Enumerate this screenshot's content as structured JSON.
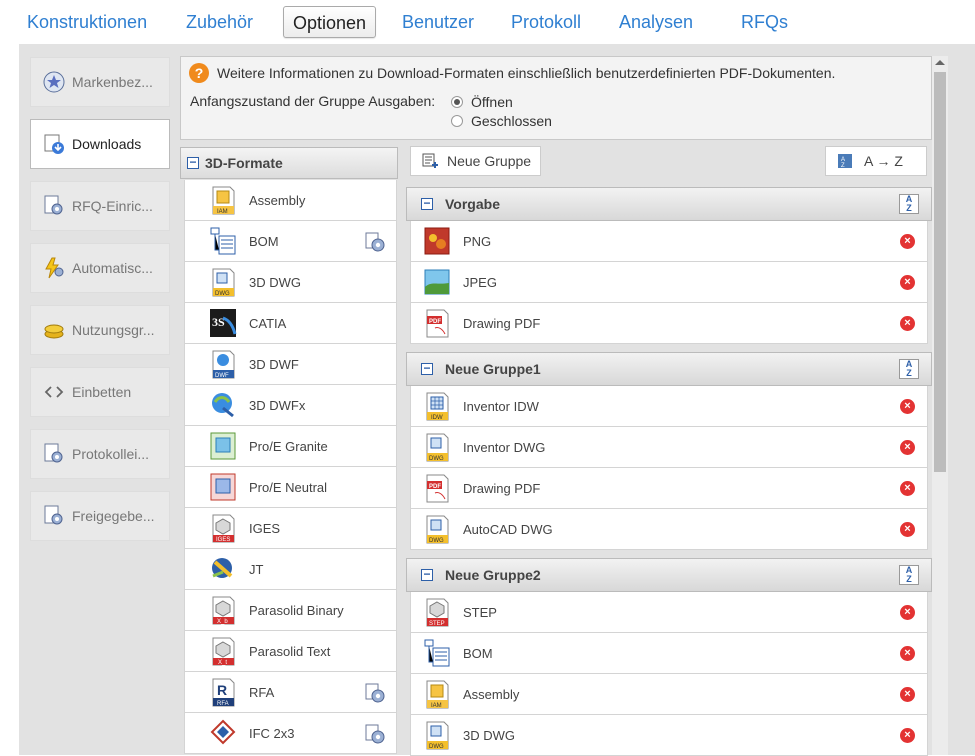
{
  "nav": {
    "tabs": [
      {
        "label": "Konstruktionen"
      },
      {
        "label": "Zubehör"
      },
      {
        "label": "Optionen"
      },
      {
        "label": "Benutzer"
      },
      {
        "label": "Protokoll"
      },
      {
        "label": "Analysen"
      },
      {
        "label": "RFQs"
      }
    ],
    "active": "Optionen"
  },
  "sidebar": {
    "items": [
      {
        "label": "Markenbez...",
        "icon": "star-icon"
      },
      {
        "label": "Downloads",
        "icon": "download-icon"
      },
      {
        "label": "RFQ-Einric...",
        "icon": "settings-doc-icon"
      },
      {
        "label": "Automatisc...",
        "icon": "lightning-gear-icon"
      },
      {
        "label": "Nutzungsgr...",
        "icon": "coins-icon"
      },
      {
        "label": "Einbetten",
        "icon": "code-icon"
      },
      {
        "label": "Protokollei...",
        "icon": "settings-doc-icon"
      },
      {
        "label": "Freigegebe...",
        "icon": "settings-doc-icon"
      }
    ],
    "active": "Downloads"
  },
  "info": {
    "text": "Weitere Informationen zu Download-Formaten einschließlich benutzerdefinierten PDF-Dokumenten.",
    "group_label": "Anfangszustand der Gruppe Ausgaben:",
    "options": [
      {
        "label": "Öffnen",
        "selected": true
      },
      {
        "label": "Geschlossen",
        "selected": false
      }
    ]
  },
  "formats": {
    "header": "3D-Formate",
    "items": [
      {
        "label": "Assembly",
        "icon": "assembly-icon",
        "gear": false
      },
      {
        "label": "BOM",
        "icon": "bom-icon",
        "gear": true
      },
      {
        "label": "3D DWG",
        "icon": "dwg-icon",
        "gear": false
      },
      {
        "label": "CATIA",
        "icon": "catia-icon",
        "gear": false
      },
      {
        "label": "3D DWF",
        "icon": "dwf-icon",
        "gear": false
      },
      {
        "label": "3D DWFx",
        "icon": "dwfx-icon",
        "gear": false
      },
      {
        "label": "Pro/E Granite",
        "icon": "proe-granite-icon",
        "gear": false
      },
      {
        "label": "Pro/E Neutral",
        "icon": "proe-neutral-icon",
        "gear": false
      },
      {
        "label": "IGES",
        "icon": "iges-icon",
        "gear": false
      },
      {
        "label": "JT",
        "icon": "jt-icon",
        "gear": false
      },
      {
        "label": "Parasolid Binary",
        "icon": "parasolid-binary-icon",
        "gear": false
      },
      {
        "label": "Parasolid Text",
        "icon": "parasolid-text-icon",
        "gear": false
      },
      {
        "label": "RFA",
        "icon": "rfa-icon",
        "gear": true
      },
      {
        "label": "IFC 2x3",
        "icon": "ifc-icon",
        "gear": true
      }
    ]
  },
  "toolbar": {
    "new_group_label": "Neue Gruppe",
    "sort_label": "A → Z"
  },
  "groups": [
    {
      "name": "Vorgabe",
      "items": [
        {
          "label": "PNG",
          "icon": "png-icon"
        },
        {
          "label": "JPEG",
          "icon": "jpeg-icon"
        },
        {
          "label": "Drawing PDF",
          "icon": "pdf-icon"
        }
      ]
    },
    {
      "name": "Neue Gruppe1",
      "items": [
        {
          "label": "Inventor IDW",
          "icon": "idw-icon"
        },
        {
          "label": "Inventor DWG",
          "icon": "dwg-icon"
        },
        {
          "label": "Drawing PDF",
          "icon": "pdf-icon"
        },
        {
          "label": "AutoCAD DWG",
          "icon": "dwg-icon"
        }
      ]
    },
    {
      "name": "Neue Gruppe2",
      "items": [
        {
          "label": "STEP",
          "icon": "step-icon"
        },
        {
          "label": "BOM",
          "icon": "bom-icon"
        },
        {
          "label": "Assembly",
          "icon": "assembly-icon"
        },
        {
          "label": "3D DWG",
          "icon": "dwg-icon"
        }
      ]
    }
  ],
  "colors": {
    "accent": "#2f7fd1",
    "delete": "#e33333",
    "info": "#f08a1c"
  }
}
